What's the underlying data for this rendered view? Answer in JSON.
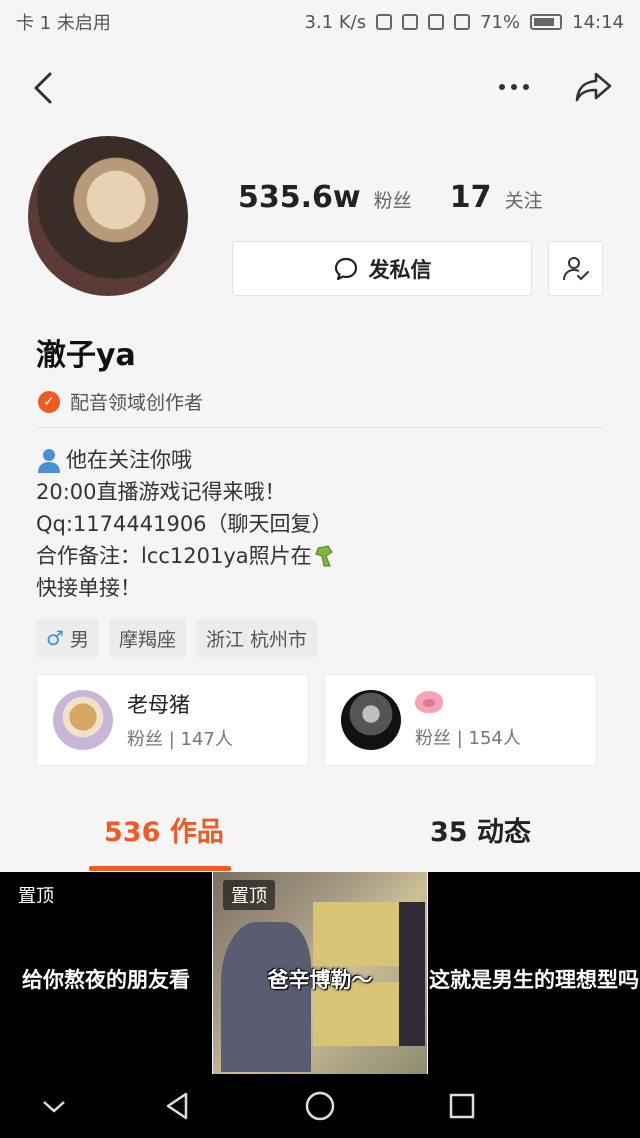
{
  "status_bar": {
    "carrier": "卡 1 未启用",
    "speed": "3.1 K/s",
    "battery": "71%",
    "time": "14:14"
  },
  "profile": {
    "fans_count": "535.6w",
    "fans_label": "粉丝",
    "following_count": "17",
    "following_label": "关注",
    "message_button": "发私信",
    "username": "澈子ya",
    "verify_text": "配音领域创作者",
    "bio": [
      "他在关注你哦",
      "20:00直播游戏记得来哦！",
      "Qq:1174441906（聊天回复）",
      "合作备注：lcc1201ya照片在",
      "快接单接！"
    ],
    "tags": [
      "男",
      "摩羯座",
      "浙江 杭州市"
    ]
  },
  "fans": [
    {
      "name": "老母猪",
      "sub": "粉丝 | 147人"
    },
    {
      "name": "",
      "sub": "粉丝 | 154人"
    }
  ],
  "tabs": {
    "works": "536 作品",
    "dynamic": "35 动态"
  },
  "videos": [
    {
      "badge": "置顶",
      "caption": "给你熬夜的朋友看"
    },
    {
      "badge": "置顶",
      "caption": "爸辛博勒～"
    },
    {
      "badge": "",
      "caption": "这就是男生的理想型吗"
    }
  ],
  "colors": {
    "accent": "#f05b22",
    "male": "#3b8fe0"
  }
}
